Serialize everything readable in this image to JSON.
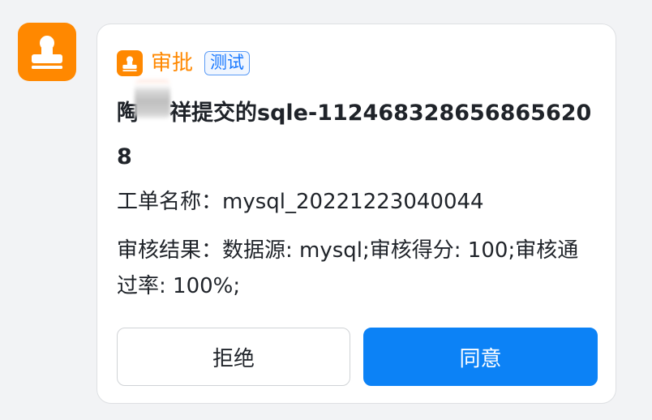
{
  "colors": {
    "brand_orange": "#ff8800",
    "primary_blue": "#0c82f6",
    "tag_blue": "#1677ff"
  },
  "avatar": {
    "icon": "stamp-icon"
  },
  "card": {
    "app_icon": "stamp-icon",
    "app_name": "审批",
    "tag": "测试",
    "title_prefix": "陶",
    "title_suffix": "祥提交的sqle-1124683286568656208",
    "fields": [
      {
        "label": "工单名称：",
        "value": "mysql_20221223040044"
      },
      {
        "label": "审核结果：",
        "value": "数据源: mysql;审核得分: 100;审核通过率: 100%;"
      }
    ],
    "buttons": {
      "reject": "拒绝",
      "approve": "同意"
    }
  }
}
